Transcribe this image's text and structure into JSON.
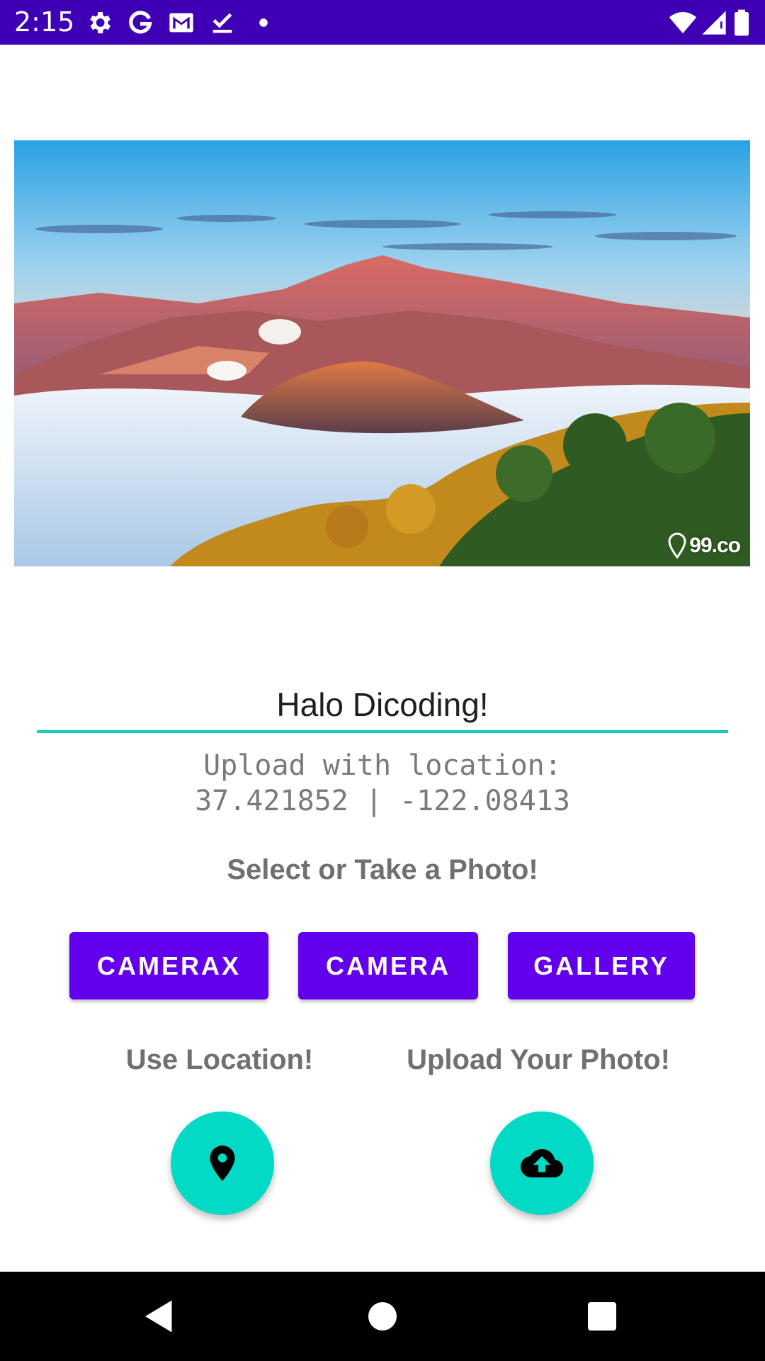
{
  "status_bar": {
    "time": "2:15",
    "left_icons": [
      "gear-icon",
      "google-icon",
      "gmail-icon",
      "download-done-icon",
      "dot-icon"
    ],
    "right_icons": [
      "wifi-icon",
      "cell-signal-icon",
      "battery-icon"
    ],
    "background": "#3f00b5"
  },
  "photo": {
    "watermark_text": "99.co"
  },
  "form": {
    "description_value": "Halo Dicoding!",
    "location_line1": "Upload with location:",
    "location_line2": "37.421852 | -122.08413",
    "select_label": "Select or Take a Photo!",
    "accent_color": "#1ec8c0"
  },
  "buttons": {
    "camerax": "CAMERAX",
    "camera": "CAMERA",
    "gallery": "GALLERY",
    "color": "#6200ee"
  },
  "actions": {
    "location_label": "Use Location!",
    "location_icon": "location-pin-icon",
    "upload_label": "Upload Your Photo!",
    "upload_icon": "cloud-upload-icon",
    "fab_color": "#03dac5"
  },
  "nav_bar": {
    "icons": [
      "back-icon",
      "home-icon",
      "recents-icon"
    ]
  }
}
